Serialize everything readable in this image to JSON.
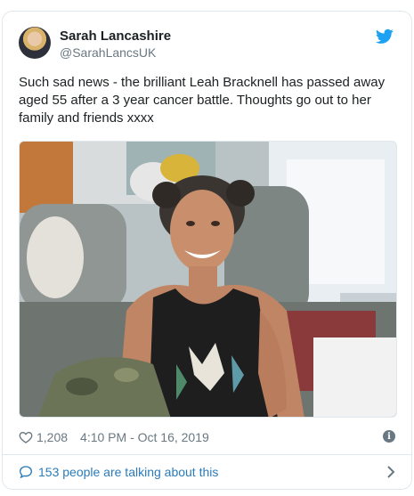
{
  "author": {
    "display_name": "Sarah Lancashire",
    "handle": "@SarahLancsUK"
  },
  "tweet": {
    "text": "Such sad news - the brilliant Leah Bracknell has passed away aged 55 after a 3 year cancer battle. Thoughts go out to her family and friends xxxx"
  },
  "meta": {
    "likes": "1,208",
    "timestamp": "4:10 PM - Oct 16, 2019"
  },
  "footer": {
    "talk_label": "153 people are talking about this"
  },
  "icons": {
    "brand": "twitter-bird-icon",
    "like": "heart-icon",
    "info": "info-icon",
    "reply": "speech-bubble-icon",
    "chevron": "chevron-right-icon"
  },
  "colors": {
    "accent": "#1da1f2",
    "link": "#2b7bb9",
    "secondary_text": "#697882",
    "border": "#e1e8ed"
  }
}
